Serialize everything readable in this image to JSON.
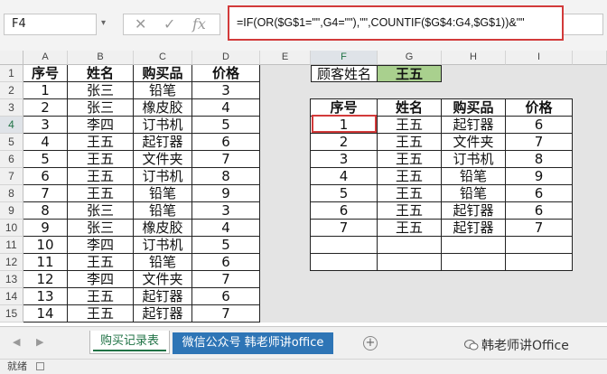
{
  "formula_bar": {
    "name_box": "F4",
    "cancel_glyph": "✕",
    "enter_glyph": "✓",
    "fx_label": "fx",
    "formula": "=IF(OR($G$1=\"\",G4=\"\"),\"\",COUNTIF($G$4:G4,$G$1))&\"\""
  },
  "columns": [
    "A",
    "B",
    "C",
    "D",
    "E",
    "F",
    "G",
    "H",
    "I"
  ],
  "rows": [
    "1",
    "2",
    "3",
    "4",
    "5",
    "6",
    "7",
    "8",
    "9",
    "10",
    "11",
    "12",
    "13",
    "14",
    "15"
  ],
  "active_cell": {
    "column": "F",
    "row": "4"
  },
  "left_table": {
    "headers": [
      "序号",
      "姓名",
      "购买品",
      "价格"
    ],
    "rows": [
      [
        "1",
        "张三",
        "铅笔",
        "3"
      ],
      [
        "2",
        "张三",
        "橡皮胶",
        "4"
      ],
      [
        "3",
        "李四",
        "订书机",
        "5"
      ],
      [
        "4",
        "王五",
        "起钉器",
        "6"
      ],
      [
        "5",
        "王五",
        "文件夹",
        "7"
      ],
      [
        "6",
        "王五",
        "订书机",
        "8"
      ],
      [
        "7",
        "王五",
        "铅笔",
        "9"
      ],
      [
        "8",
        "张三",
        "铅笔",
        "3"
      ],
      [
        "9",
        "张三",
        "橡皮胶",
        "4"
      ],
      [
        "10",
        "李四",
        "订书机",
        "5"
      ],
      [
        "11",
        "王五",
        "铅笔",
        "6"
      ],
      [
        "12",
        "李四",
        "文件夹",
        "7"
      ],
      [
        "13",
        "王五",
        "起钉器",
        "6"
      ],
      [
        "14",
        "王五",
        "起钉器",
        "7"
      ]
    ]
  },
  "lookup": {
    "label": "顾客姓名",
    "value": "王五",
    "value_bg": "#a9d08e"
  },
  "right_table": {
    "headers": [
      "序号",
      "姓名",
      "购买品",
      "价格"
    ],
    "rows": [
      [
        "1",
        "王五",
        "起钉器",
        "6"
      ],
      [
        "2",
        "王五",
        "文件夹",
        "7"
      ],
      [
        "3",
        "王五",
        "订书机",
        "8"
      ],
      [
        "4",
        "王五",
        "铅笔",
        "9"
      ],
      [
        "5",
        "王五",
        "铅笔",
        "6"
      ],
      [
        "6",
        "王五",
        "起钉器",
        "6"
      ],
      [
        "7",
        "王五",
        "起钉器",
        "7"
      ],
      [
        "",
        "",
        "",
        ""
      ],
      [
        "",
        "",
        "",
        ""
      ]
    ]
  },
  "sheet_tabs": {
    "nav_prev": "◀",
    "nav_next": "▶",
    "active": "购买记录表",
    "other": "微信公众号 韩老师讲office",
    "add": "+"
  },
  "watermark": "韩老师讲Office",
  "status": "就绪",
  "colors": {
    "accent": "#217346",
    "selection": "#d23a3a",
    "tab_blue": "#2e75b6"
  }
}
